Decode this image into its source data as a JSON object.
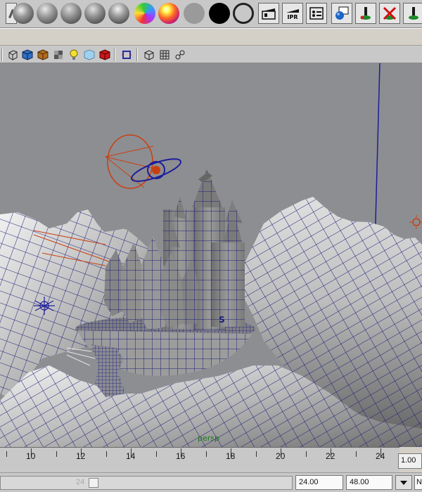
{
  "shelf": {
    "items": [
      {
        "name": "clear-shelf-icon"
      },
      {
        "name": "phong-sphere-icon"
      },
      {
        "name": "blinn-sphere-icon"
      },
      {
        "name": "lambert-sphere-icon"
      },
      {
        "name": "phonge-sphere-icon"
      },
      {
        "name": "anisotropic-sphere-icon"
      },
      {
        "name": "rainbow-shader-icon"
      },
      {
        "name": "ramp-shader-icon"
      },
      {
        "name": "layered-shader-icon"
      },
      {
        "name": "surface-shader-icon"
      },
      {
        "name": "use-background-icon"
      },
      {
        "name": "render-view-icon"
      },
      {
        "name": "ipr-render-icon"
      },
      {
        "name": "render-settings-icon"
      },
      {
        "name": "hypershade-icon"
      },
      {
        "name": "light-link-icon"
      },
      {
        "name": "break-light-link-icon"
      },
      {
        "name": "make-light-link-icon"
      }
    ],
    "ipr_label": "IPR"
  },
  "panel_toolbar": {
    "items": [
      "wireframe-icon",
      "smooth-shade-icon",
      "shade-all-icon",
      "textured-icon",
      "lights-icon",
      "xray-icon",
      "default-material-icon",
      "isolate-select-icon",
      "grid-icon",
      "resolution-gate-icon",
      "camera-attributes-icon"
    ]
  },
  "viewport": {
    "camera_label": "persp",
    "surface_letter": "S"
  },
  "timeline": {
    "labels": [
      "10",
      "12",
      "14",
      "16",
      "18",
      "20",
      "22",
      "24"
    ],
    "current_frame": "1.00"
  },
  "range": {
    "handle_value": "24",
    "start_value": "24.00",
    "end_value": "48.00",
    "trailing_text": "N"
  }
}
